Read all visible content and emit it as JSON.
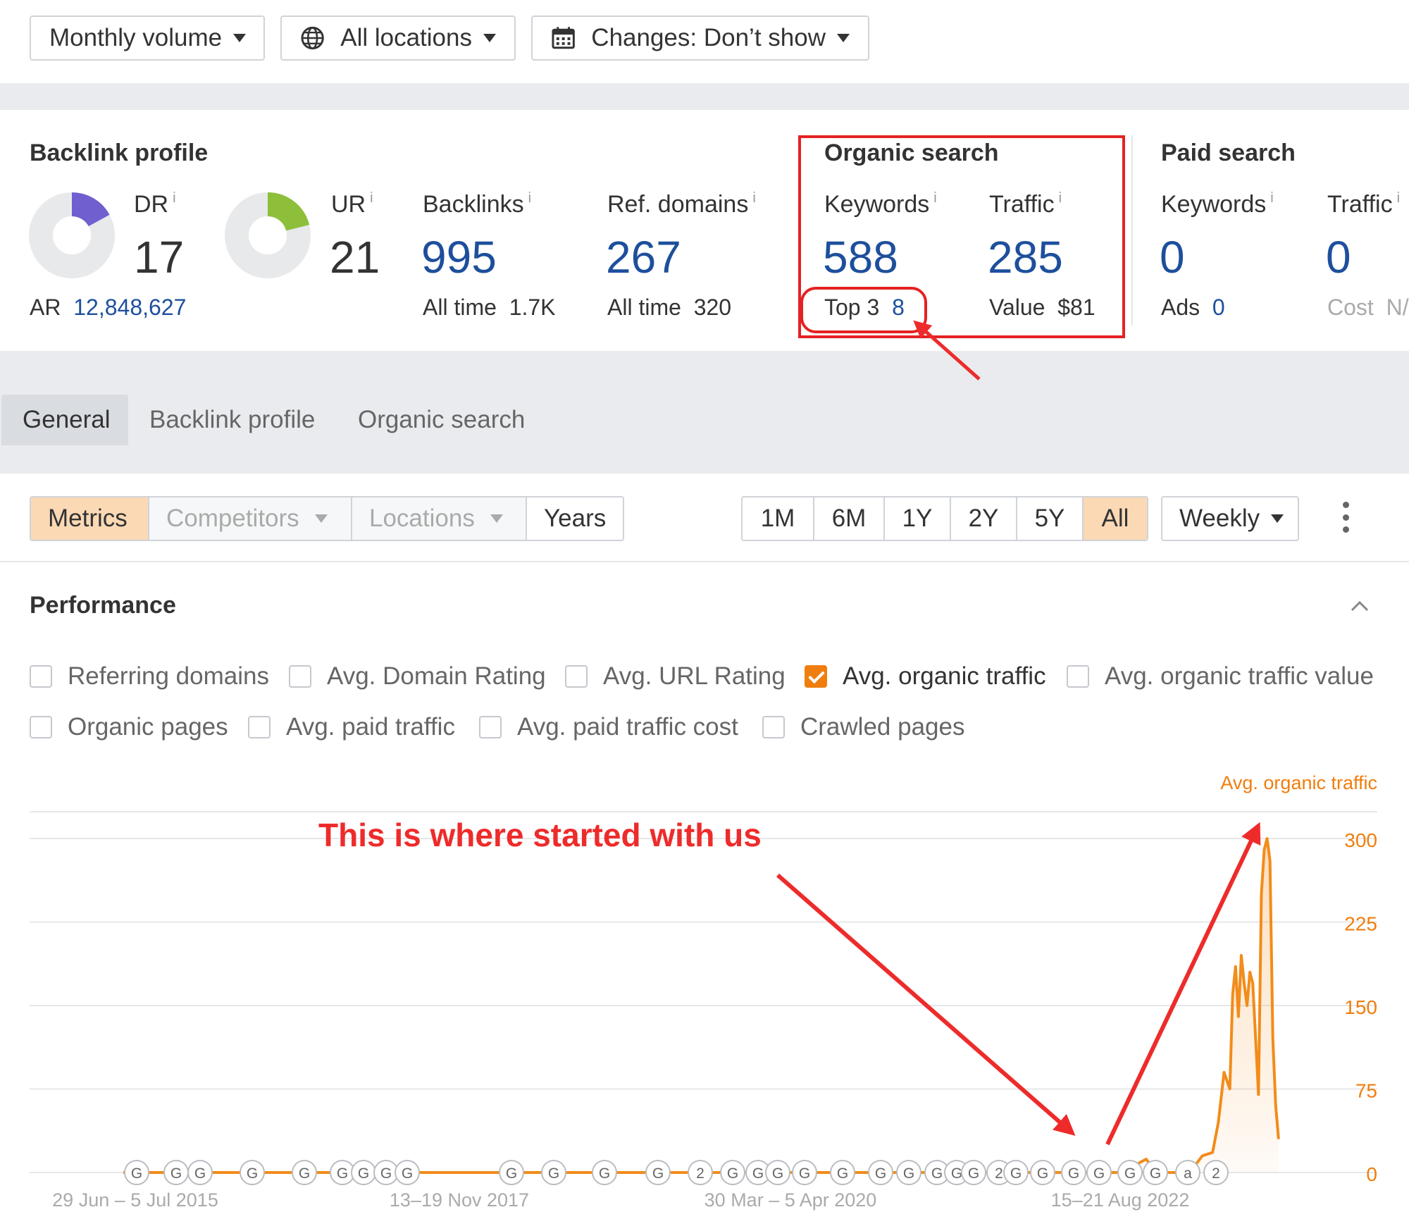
{
  "toolbar": {
    "volume_label": "Monthly volume",
    "locations_label": "All locations",
    "changes_label": "Changes: Don’t show"
  },
  "overview": {
    "backlink_profile": {
      "title": "Backlink profile",
      "dr_label": "DR",
      "dr_value": "17",
      "dr_fraction": 0.17,
      "ur_label": "UR",
      "ur_value": "21",
      "ur_fraction": 0.21,
      "ar_label": "AR",
      "ar_value": "12,848,627",
      "backlinks_label": "Backlinks",
      "backlinks_value": "995",
      "backlinks_alltime_label": "All time",
      "backlinks_alltime_value": "1.7K",
      "refdomains_label": "Ref. domains",
      "refdomains_value": "267",
      "refdomains_alltime_label": "All time",
      "refdomains_alltime_value": "320",
      "info_mark": "i"
    },
    "organic_search": {
      "title": "Organic search",
      "keywords_label": "Keywords",
      "keywords_value": "588",
      "top3_label": "Top 3",
      "top3_value": "8",
      "traffic_label": "Traffic",
      "traffic_value": "285",
      "value_label": "Value",
      "value_value": "$81"
    },
    "paid_search": {
      "title": "Paid search",
      "keywords_label": "Keywords",
      "keywords_value": "0",
      "ads_label": "Ads",
      "ads_value": "0",
      "traffic_label": "Traffic",
      "traffic_value": "0",
      "cost_label": "Cost",
      "cost_value": "N/"
    }
  },
  "tabs": [
    "General",
    "Backlink profile",
    "Organic search"
  ],
  "controls": {
    "metrics_label": "Metrics",
    "competitors_label": "Competitors",
    "locations_label": "Locations",
    "years_label": "Years",
    "ranges": [
      "1M",
      "6M",
      "1Y",
      "2Y",
      "5Y",
      "All"
    ],
    "active_range": "All",
    "interval_label": "Weekly"
  },
  "performance": {
    "title": "Performance",
    "checkboxes": [
      {
        "label": "Referring domains",
        "checked": false
      },
      {
        "label": "Avg. Domain Rating",
        "checked": false
      },
      {
        "label": "Avg. URL Rating",
        "checked": false
      },
      {
        "label": "Avg. organic traffic",
        "checked": true
      },
      {
        "label": "Avg. organic traffic value",
        "checked": false
      },
      {
        "label": "Organic pages",
        "checked": false
      },
      {
        "label": "Avg. paid traffic",
        "checked": false
      },
      {
        "label": "Avg. paid traffic cost",
        "checked": false
      },
      {
        "label": "Crawled pages",
        "checked": false
      }
    ]
  },
  "annotation": {
    "text": "This is where started with us",
    "color": "#ee2b2b"
  },
  "chart_data": {
    "type": "area",
    "series": [
      {
        "name": "Avg. organic traffic",
        "color": "#f28c1a",
        "x": [
          "2015-07-01",
          "2016-06-01",
          "2017-06-01",
          "2018-06-01",
          "2019-06-01",
          "2020-06-01",
          "2021-06-01",
          "2022-03-01",
          "2022-05-01",
          "2022-05-15",
          "2022-06-01",
          "2022-06-15",
          "2022-07-01",
          "2022-08-15",
          "2022-09-15",
          "2022-10-10",
          "2022-10-24",
          "2022-11-07",
          "2022-11-21",
          "2022-11-28",
          "2022-12-05",
          "2022-12-12",
          "2022-12-19",
          "2022-12-26",
          "2023-01-02",
          "2023-01-09",
          "2023-01-16",
          "2023-01-23",
          "2023-01-30",
          "2023-02-06",
          "2023-02-13",
          "2023-02-20",
          "2023-02-27",
          "2023-03-06",
          "2023-03-13",
          "2023-03-20"
        ],
        "values": [
          0,
          0,
          0,
          0,
          0,
          0,
          0,
          0,
          12,
          5,
          0,
          0,
          0,
          0,
          15,
          18,
          45,
          90,
          75,
          160,
          185,
          140,
          195,
          170,
          150,
          180,
          170,
          120,
          70,
          250,
          290,
          300,
          280,
          120,
          60,
          30
        ]
      }
    ],
    "x_tick_labels": [
      "29 Jun – 5 Jul 2015",
      "13–19 Nov 2017",
      "30 Mar – 5 Apr 2020",
      "15–21 Aug 2022"
    ],
    "y_tick_labels": [
      "0",
      "75",
      "150",
      "225",
      "300"
    ],
    "ylim": [
      0,
      300
    ],
    "y_axis_title": "Avg. organic traffic",
    "y_axis_side": "right",
    "grid": true,
    "event_markers": [
      "G",
      "G",
      "G",
      "G",
      "G",
      "G",
      "G",
      "G",
      "G",
      "G",
      "G",
      "G",
      "G",
      "2",
      "G",
      "G",
      "G",
      "G",
      "G",
      "G",
      "G",
      "G",
      "G",
      "G",
      "2",
      "G",
      "G",
      "G",
      "G",
      "G",
      "G",
      "a",
      "2"
    ]
  }
}
